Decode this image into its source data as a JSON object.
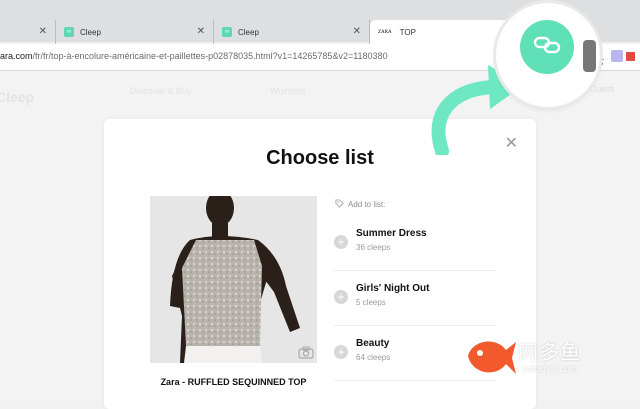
{
  "browser": {
    "tabs": [
      {
        "label": "Cleep"
      },
      {
        "label": "Cleep"
      },
      {
        "label": "TOP",
        "favicon_text": "ZARA"
      }
    ],
    "url": {
      "host": "ara.com",
      "path": "/fr/fr/top-à-encolure-américaine-et-paillettes-p02878035.html?v1=14265785&v2=1180380"
    }
  },
  "page": {
    "logo": "Cleep",
    "nav": [
      "Discover & Buy",
      "Wishlists",
      "Guest"
    ]
  },
  "modal": {
    "title": "Choose list",
    "add_to_list": "Add to list:",
    "product_name": "Zara - RUFFLED SEQUINNED TOP",
    "lists": [
      {
        "name": "Summer Dress",
        "count": "36 cleeps"
      },
      {
        "name": "Girls' Night Out",
        "count": "5 cleeps"
      },
      {
        "name": "Beauty",
        "count": "64 cleeps"
      }
    ]
  },
  "watermark": {
    "title": "网多鱼",
    "subtitle": "wduoyu.com"
  },
  "colors": {
    "accent": "#5fe0b6",
    "arrow": "#6ee8c2",
    "watermark_fish": "#f25a2e"
  },
  "icons": [
    "link-icon",
    "close-icon",
    "tag-icon",
    "plus-icon",
    "camera-icon",
    "curved-arrow-icon"
  ]
}
